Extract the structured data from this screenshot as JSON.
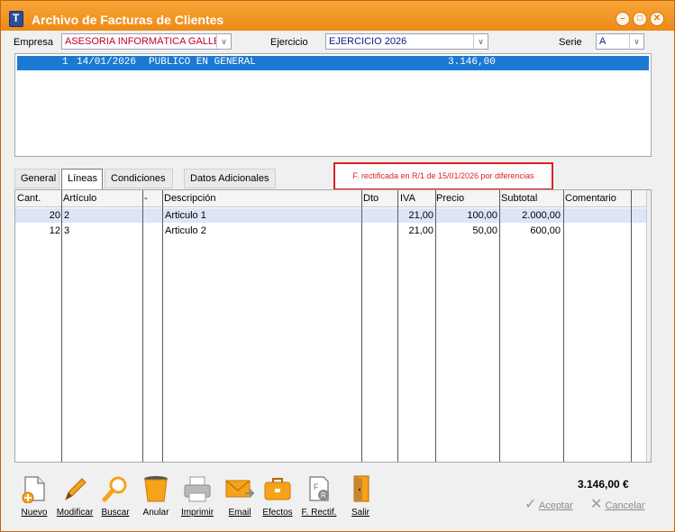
{
  "window": {
    "title": "Archivo de Facturas de Clientes"
  },
  "filters": {
    "empresa_label": "Empresa",
    "empresa_value": "ASESORIA INFORMÁTICA GALLEGA",
    "ejercicio_label": "Ejercicio",
    "ejercicio_value": "EJERCICIO 2026",
    "serie_label": "Serie",
    "serie_value": "A"
  },
  "documents": [
    {
      "number": "1",
      "date": "14/01/2026",
      "client": "PUBLICO EN GENERAL",
      "total": "3.146,00"
    }
  ],
  "tabs": [
    "General",
    "Líneas",
    "Condiciones",
    "Datos Adicionales"
  ],
  "active_tab": "Líneas",
  "notice": "F. rectificada en R/1 de 15/01/2026 por diferencias",
  "grid": {
    "columns": [
      "Cant.",
      "Artículo",
      "-",
      "Descripción",
      "Dto",
      "IVA",
      "Precio",
      "Subtotal",
      "Comentario"
    ],
    "rows": [
      {
        "cant": "20",
        "articulo": "2",
        "dash": "",
        "descripcion": "Articulo 1",
        "dto": "",
        "iva": "21,00",
        "precio": "100,00",
        "subtotal": "2.000,00",
        "comentario": ""
      },
      {
        "cant": "12",
        "articulo": "3",
        "dash": "",
        "descripcion": "Articulo 2",
        "dto": "",
        "iva": "21,00",
        "precio": "50,00",
        "subtotal": "600,00",
        "comentario": ""
      }
    ]
  },
  "toolbar": {
    "nuevo": "Nuevo",
    "modificar": "Modificar",
    "buscar": "Buscar",
    "anular": "Anular",
    "imprimir": "Imprimir",
    "email": "Email",
    "efectos": "Efectos",
    "rectif": "F. Rectif.",
    "salir": "Salir"
  },
  "summary": {
    "total": "3.146,00 €"
  },
  "dialog": {
    "aceptar": "Aceptar",
    "cancelar": "Cancelar"
  },
  "colors": {
    "titlebar": "#ee8a16",
    "selection": "#1b79d1",
    "notice": "#e02020"
  }
}
